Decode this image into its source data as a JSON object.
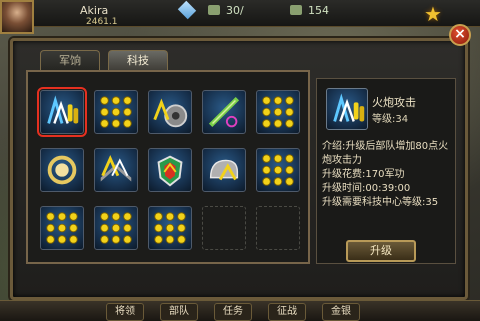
{
  "hud": {
    "player_name": "Akira",
    "sub_value": "2461.1",
    "resource_a": "30/",
    "resource_b": "154"
  },
  "tabs": [
    {
      "label": "军饷",
      "active": false
    },
    {
      "label": "科技",
      "active": true
    }
  ],
  "grid": {
    "slots": [
      {
        "icon": "artillery-shells-icon",
        "selected": true
      },
      {
        "icon": "dot-formation-icon"
      },
      {
        "icon": "gear-rank-icon"
      },
      {
        "icon": "rifle-bullet-icon"
      },
      {
        "icon": "dot-formation-icon"
      },
      {
        "icon": "target-scope-icon"
      },
      {
        "icon": "rank-chevron-icon"
      },
      {
        "icon": "shield-emblem-icon"
      },
      {
        "icon": "helmet-rank-icon"
      },
      {
        "icon": "dot-formation-icon"
      },
      {
        "icon": "dot-formation-icon"
      },
      {
        "icon": "dot-formation-icon"
      },
      {
        "icon": "dot-formation-icon"
      },
      {
        "icon": "empty-slot"
      },
      {
        "icon": "empty-slot"
      }
    ]
  },
  "detail": {
    "name": "火炮攻击",
    "level": "等级:34",
    "desc_line1": "介绍:升级后部队增加80点火",
    "desc_line2": "炮攻击力",
    "cost": "升级花费:170军功",
    "time": "升级时间:00:39:00",
    "requirement": "升级需要科技中心等级:35"
  },
  "upgrade_label": "升级",
  "close_label": "×",
  "colors": {
    "selected_border": "#e53020",
    "accent_gold": "#c8a050",
    "icon_yellow": "#f2d21a"
  },
  "bottom_bar": [
    "将领",
    "部队",
    "任务",
    "征战",
    "金银"
  ]
}
